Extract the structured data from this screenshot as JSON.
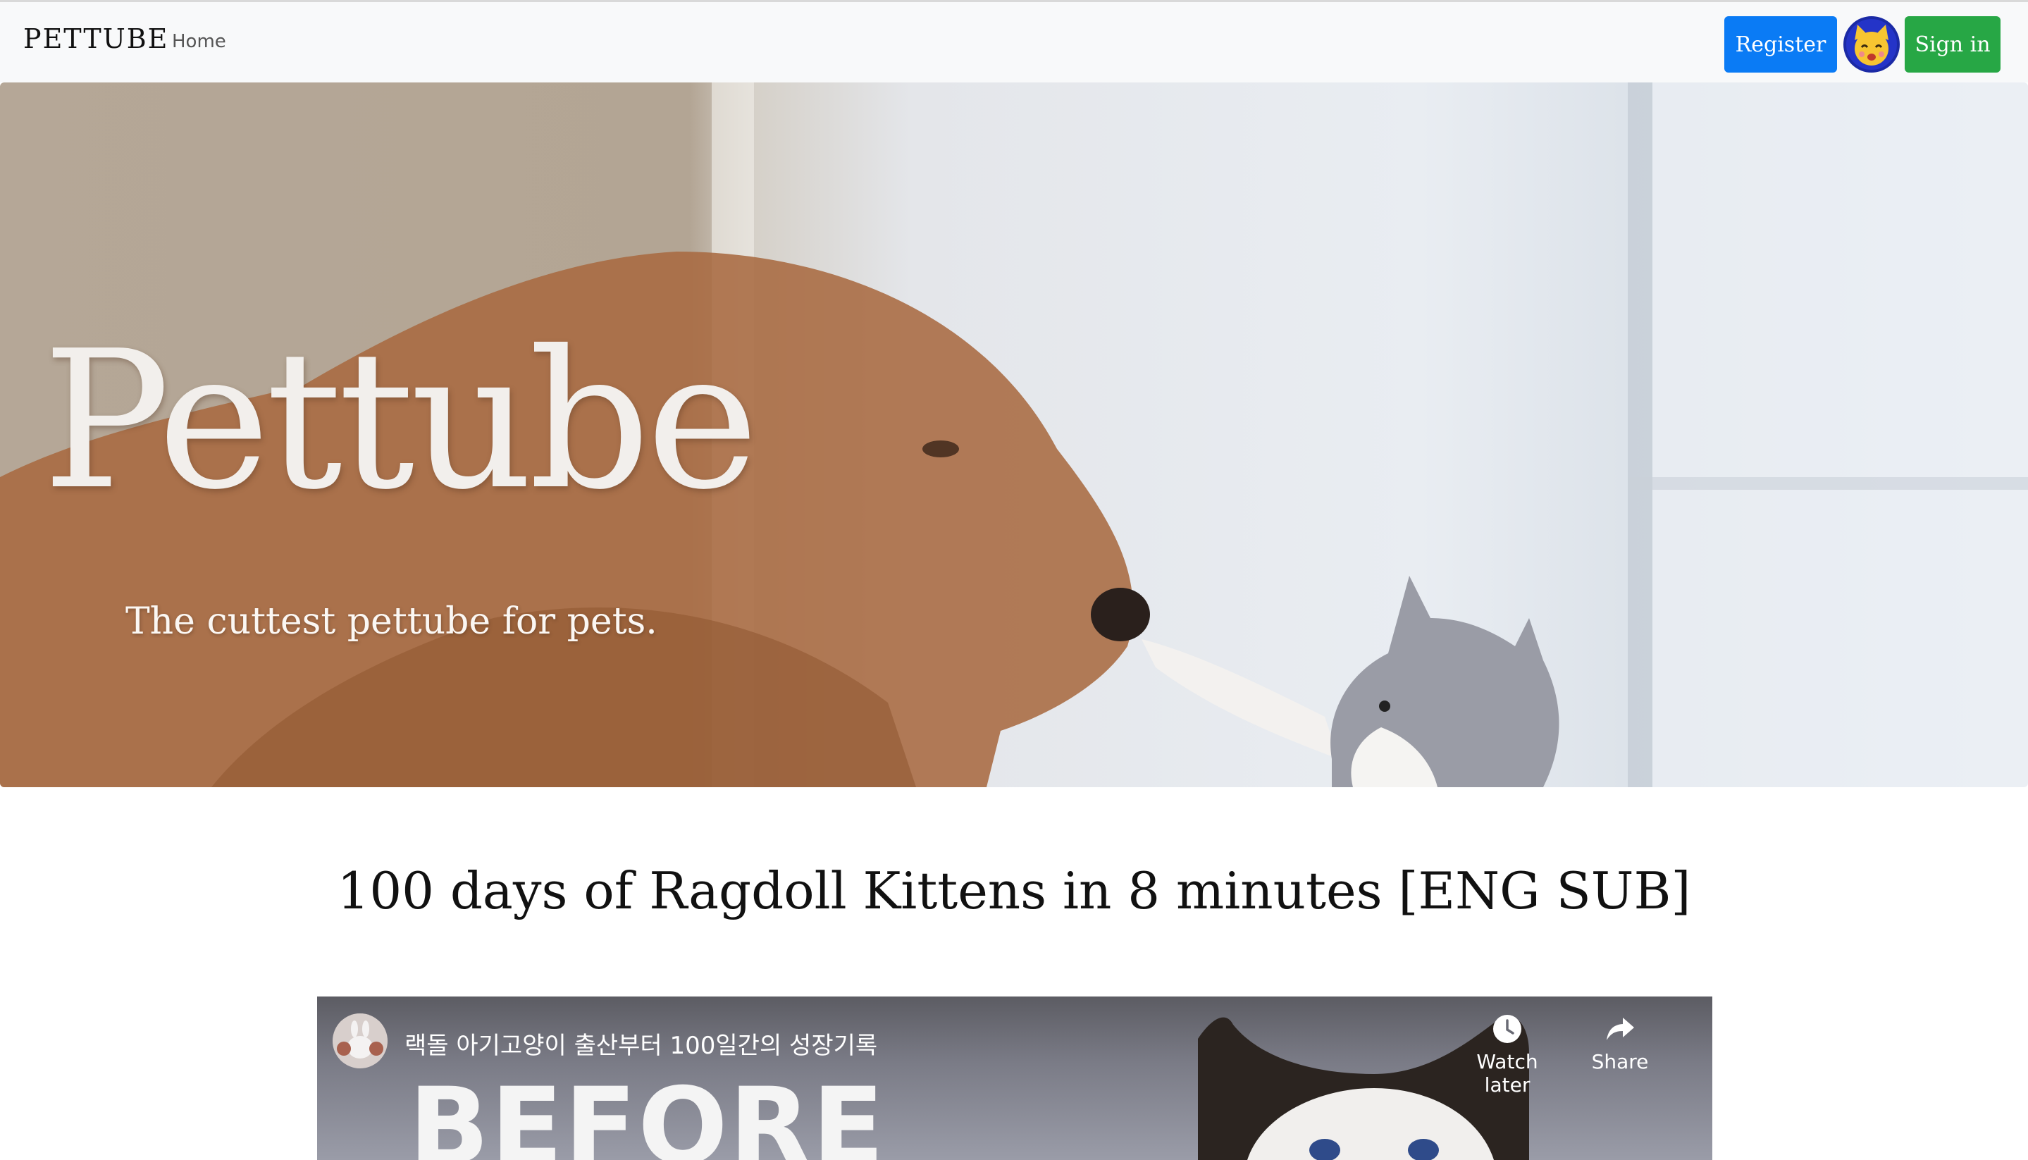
{
  "navbar": {
    "brand": "PETTUBE",
    "home_label": "Home",
    "register_label": "Register",
    "signin_label": "Sign in",
    "avatar_icon": "cat-face-icon"
  },
  "hero": {
    "title": "Pettube",
    "subtitle": "The cuttest pettube for pets."
  },
  "video": {
    "title": "100 days of Ragdoll Kittens in 8 minutes [ENG SUB]",
    "player": {
      "embed_title": "랙돌 아기고양이 출산부터 100일간의 성장기록",
      "thumbnail_text": "BEFORE",
      "watch_later_label": "Watch later",
      "share_label": "Share",
      "channel_icon": "channel-avatar-icon"
    }
  },
  "colors": {
    "register": "#0a7bf5",
    "signin": "#27a745",
    "navbar_bg": "#f8f9fa"
  }
}
